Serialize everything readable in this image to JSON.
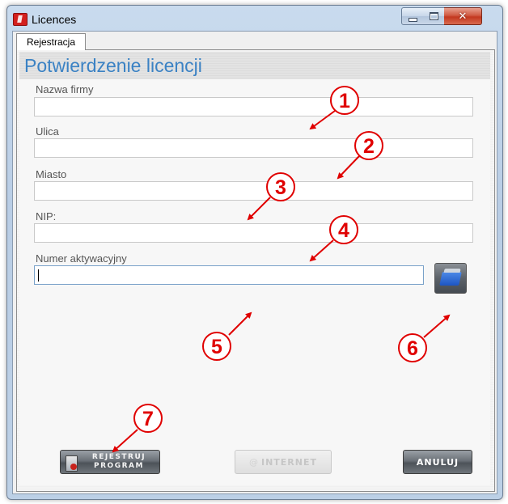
{
  "window": {
    "title": "Licences",
    "close_glyph": "✕"
  },
  "tabs": [
    {
      "label": "Rejestracja",
      "active": true
    }
  ],
  "page_title": "Potwierdzenie licencji",
  "fields": [
    {
      "label": "Nazwa firmy",
      "value": ""
    },
    {
      "label": "Ulica",
      "value": ""
    },
    {
      "label": "Miasto",
      "value": ""
    },
    {
      "label": "NIP:",
      "value": ""
    },
    {
      "label": "Numer aktywacyjny",
      "value": ""
    }
  ],
  "buttons": {
    "register_line1": "REJESTRUJ",
    "register_line2": "PROGRAM",
    "internet_at": "@",
    "internet": "INTERNET",
    "cancel": "ANULUJ"
  },
  "annotations": [
    "1",
    "2",
    "3",
    "4",
    "5",
    "6",
    "7"
  ],
  "colors": {
    "title_blue": "#3b82c4",
    "annotation_red": "#e00000",
    "close_red": "#c3381f"
  },
  "icons": [
    "app-icon",
    "minimize-icon",
    "maximize-icon",
    "close-icon",
    "folder-icon",
    "register-icon"
  ]
}
